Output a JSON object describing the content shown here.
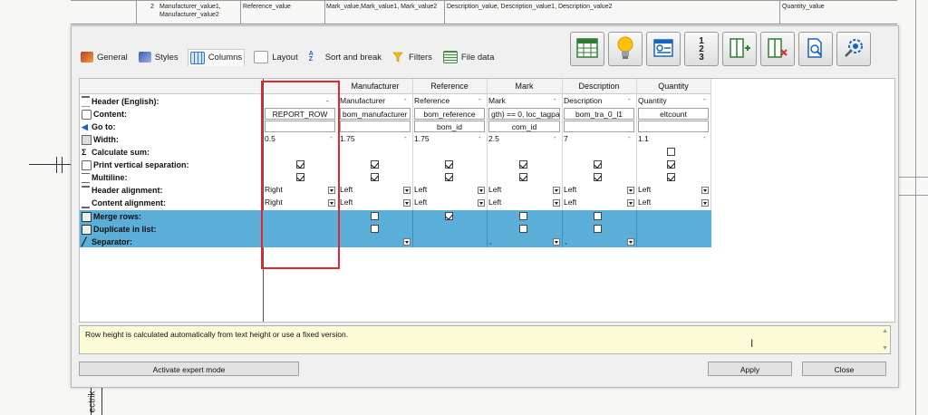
{
  "background": {
    "top_texts": [
      {
        "id": "bg-row-num",
        "text": "2"
      },
      {
        "id": "bg-manufacturer-1",
        "text": "Manufacturer_value1,"
      },
      {
        "id": "bg-manufacturer-2",
        "text": "Manufacturer_value2"
      },
      {
        "id": "bg-reference",
        "text": "Reference_value"
      },
      {
        "id": "bg-mark",
        "text": "Mark_value,Mark_value1, Mark_value2"
      },
      {
        "id": "bg-description",
        "text": "Description_value, Description_value1, Description_value2"
      },
      {
        "id": "bg-quantity",
        "text": "Quantity_value"
      }
    ],
    "side_text": "ectrik"
  },
  "tabs": [
    {
      "label": "General",
      "icon": "general-icon"
    },
    {
      "label": "Styles",
      "icon": "styles-icon"
    },
    {
      "label": "Columns",
      "icon": "columns-icon",
      "active": true
    },
    {
      "label": "Layout",
      "icon": "layout-icon"
    },
    {
      "label": "Sort and break",
      "icon": "sort-icon"
    },
    {
      "label": "Filters",
      "icon": "filter-icon"
    },
    {
      "label": "File data",
      "icon": "file-data-icon"
    }
  ],
  "toolbar": [
    "table-icon",
    "lightbulb-icon",
    "table-settings-icon",
    "numbering-icon",
    "add-column-icon",
    "delete-column-icon",
    "preview-icon",
    "settings-gear-icon"
  ],
  "toolbar_numbering_digits": [
    "1",
    "2",
    "3"
  ],
  "columns": {
    "headers": [
      "",
      "Manufacturer",
      "Reference",
      "Mark",
      "Description",
      "Quantity"
    ]
  },
  "rows": {
    "header_english": {
      "label": "Header (English):",
      "values": [
        "-",
        "Manufacturer",
        "Reference",
        "Mark",
        "Description",
        "Quantity"
      ]
    },
    "content": {
      "label": "Content:",
      "values": [
        "REPORT_ROW",
        "bom_manufacturer",
        "bom_reference",
        "gth) == 0, loc_tagpa",
        "bom_tra_0_l1",
        "eltcount"
      ]
    },
    "goto": {
      "label": "Go to:",
      "values": [
        "",
        "",
        "bom_id",
        "com_id",
        "",
        ""
      ]
    },
    "width": {
      "label": "Width:",
      "values": [
        "0.5",
        "1.75",
        "1.75",
        "2.5",
        "7",
        "1.1"
      ]
    },
    "calc_sum": {
      "label": "Calculate sum:",
      "checked": [
        false,
        false,
        false,
        false,
        false,
        false
      ]
    },
    "print_vsep": {
      "label": "Print vertical separation:",
      "checked": [
        true,
        true,
        true,
        true,
        true,
        true
      ]
    },
    "multiline": {
      "label": "Multiline:",
      "checked": [
        true,
        true,
        true,
        true,
        true,
        true
      ]
    },
    "header_align": {
      "label": "Header alignment:",
      "values": [
        "Right",
        "Left",
        "Left",
        "Left",
        "Left",
        "Left"
      ]
    },
    "content_align": {
      "label": "Content alignment:",
      "values": [
        "Right",
        "Left",
        "Left",
        "Left",
        "Left",
        "Left"
      ]
    },
    "merge_rows": {
      "label": "Merge rows:",
      "checked": [
        false,
        false,
        true,
        false,
        false,
        false
      ]
    },
    "duplicate": {
      "label": "Duplicate in list:",
      "checked": [
        false,
        false,
        false,
        false,
        false,
        false
      ]
    },
    "separator": {
      "label": "Separator:",
      "values": [
        "",
        "",
        "",
        ",",
        ",",
        ""
      ]
    }
  },
  "info_text": "Row height is calculated automatically from text height or use a fixed version.",
  "buttons": {
    "expert": "Activate expert mode",
    "apply": "Apply",
    "close": "Close"
  },
  "colors": {
    "selected_row": "#5aaed8",
    "highlight_border": "#e0282e",
    "info_background": "#fcfbd8"
  }
}
